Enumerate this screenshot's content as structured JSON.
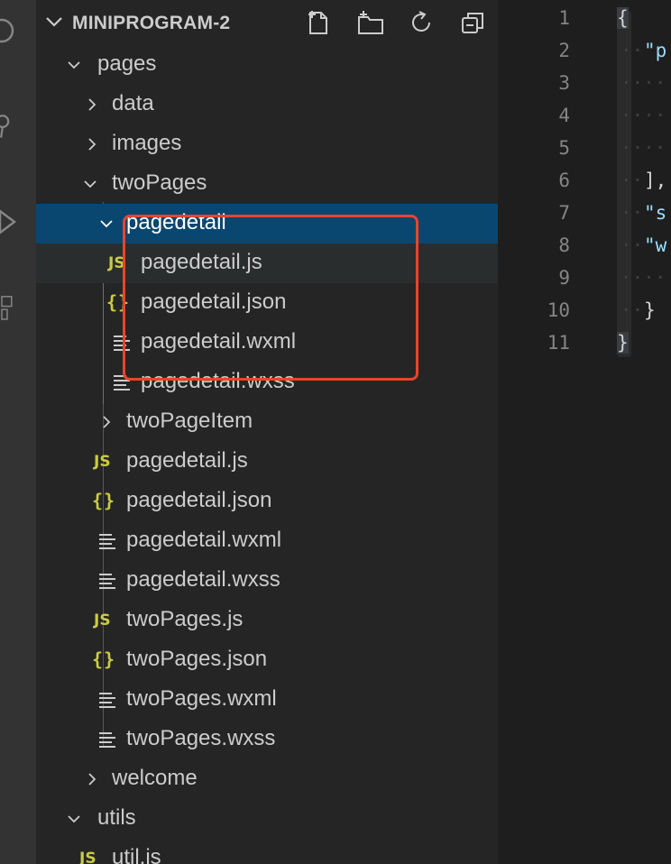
{
  "explorer": {
    "title": "MINIPROGRAM-2",
    "header_icons": [
      "new-file-icon",
      "new-folder-icon",
      "refresh-icon",
      "collapse-all-icon"
    ],
    "tree": [
      {
        "label": "pages",
        "type": "folder",
        "expanded": true
      },
      {
        "label": "data",
        "type": "folder",
        "expanded": false
      },
      {
        "label": "images",
        "type": "folder",
        "expanded": false
      },
      {
        "label": "twoPages",
        "type": "folder",
        "expanded": true
      },
      {
        "label": "pagedetail",
        "type": "folder",
        "expanded": true,
        "selected": true
      },
      {
        "label": "pagedetail.js",
        "type": "js"
      },
      {
        "label": "pagedetail.json",
        "type": "json"
      },
      {
        "label": "pagedetail.wxml",
        "type": "text"
      },
      {
        "label": "pagedetail.wxss",
        "type": "text"
      },
      {
        "label": "twoPageItem",
        "type": "folder",
        "expanded": false
      },
      {
        "label": "pagedetail.js",
        "type": "js"
      },
      {
        "label": "pagedetail.json",
        "type": "json"
      },
      {
        "label": "pagedetail.wxml",
        "type": "text"
      },
      {
        "label": "pagedetail.wxss",
        "type": "text"
      },
      {
        "label": "twoPages.js",
        "type": "js"
      },
      {
        "label": "twoPages.json",
        "type": "json"
      },
      {
        "label": "twoPages.wxml",
        "type": "text"
      },
      {
        "label": "twoPages.wxss",
        "type": "text"
      },
      {
        "label": "welcome",
        "type": "folder",
        "expanded": false
      },
      {
        "label": "utils",
        "type": "folder",
        "expanded": true
      },
      {
        "label": "util.js",
        "type": "js"
      }
    ],
    "js_badge": "JS",
    "json_badge": "{}"
  },
  "editor": {
    "line_numbers": [
      "1",
      "2",
      "3",
      "4",
      "5",
      "6",
      "7",
      "8",
      "9",
      "10",
      "11"
    ],
    "lines": [
      "{",
      "\"p",
      "",
      "",
      "",
      "],",
      "\"s",
      "\"w",
      "",
      "}",
      "}"
    ]
  },
  "colors": {
    "highlight_box": "#e8442f",
    "selection": "#094771",
    "js_icon": "#cbcb41"
  }
}
